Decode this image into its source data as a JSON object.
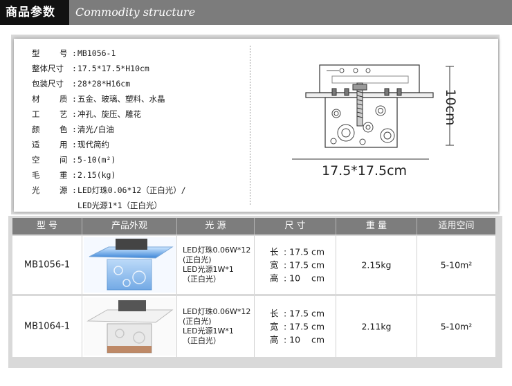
{
  "header": {
    "title": "商品参数",
    "subtitle": "Commodity structure"
  },
  "spec": {
    "rows": [
      {
        "label": [
          "型",
          "号"
        ],
        "value": "MB1056-1"
      },
      {
        "label": [
          "整体尺寸"
        ],
        "value": "17.5*17.5*H10cm"
      },
      {
        "label": [
          "包装尺寸"
        ],
        "value": "28*28*H16cm"
      },
      {
        "label": [
          "材",
          "质"
        ],
        "value": "五金、玻璃、塑料、水晶"
      },
      {
        "label": [
          "工",
          "艺"
        ],
        "value": "冲孔、旋压、雕花"
      },
      {
        "label": [
          "颜",
          "色"
        ],
        "value": "清光/白油"
      },
      {
        "label": [
          "适",
          "用"
        ],
        "value": "现代简约"
      },
      {
        "label": [
          "空",
          "间"
        ],
        "value": "5-10(m²)"
      },
      {
        "label": [
          "毛",
          "重"
        ],
        "value": "2.15(kg)"
      },
      {
        "label": [
          "光",
          "源"
        ],
        "value": "LED灯珠0.06*12（正白光）/"
      },
      {
        "label": [],
        "value": "LED光源1*1（正白光）"
      }
    ]
  },
  "diagram": {
    "width_label": "17.5*17.5cm",
    "height_label": "10cm"
  },
  "table": {
    "headers": [
      "型 号",
      "产品外观",
      "光  源",
      "尺  寸",
      "重  量",
      "适用空间"
    ],
    "rows": [
      {
        "model": "MB1056-1",
        "light": [
          "LED灯珠0.06W*12",
          "(正白光)",
          "LED光源1W*1",
          "（正白光）"
        ],
        "dims": [
          [
            "长",
            ": 17.5 cm"
          ],
          [
            "宽",
            ": 17.5 cm"
          ],
          [
            "高",
            ": 10    cm"
          ]
        ],
        "weight": "2.15kg",
        "space": "5-10m²"
      },
      {
        "model": "MB1064-1",
        "light": [
          "LED灯珠0.06W*12",
          "(正白光)",
          "LED光源1W*1",
          "（正白光）"
        ],
        "dims": [
          [
            "长",
            ": 17.5 cm"
          ],
          [
            "宽",
            ": 17.5 cm"
          ],
          [
            "高",
            ": 10    cm"
          ]
        ],
        "weight": "2.11kg",
        "space": "5-10m²"
      }
    ]
  }
}
